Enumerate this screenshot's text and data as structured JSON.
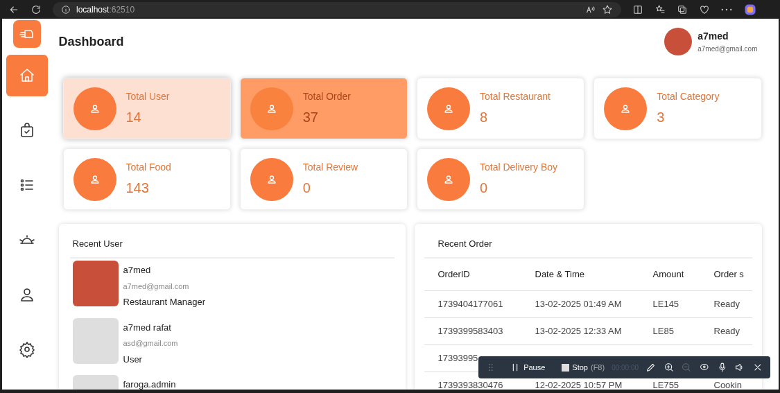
{
  "browser": {
    "url_host": "localhost",
    "url_port": ":62510"
  },
  "sidebar": {
    "items": [
      {
        "selected": true
      },
      {
        "selected": false
      },
      {
        "selected": false
      },
      {
        "selected": false
      },
      {
        "selected": false
      },
      {
        "selected": false
      }
    ]
  },
  "header": {
    "title": "Dashboard",
    "user": {
      "name": "a7med",
      "email": "a7med@gmail.com"
    }
  },
  "stats": [
    {
      "label": "Total User",
      "value": "14",
      "hovered": true,
      "selected": false
    },
    {
      "label": "Total Order",
      "value": "37",
      "hovered": false,
      "selected": true
    },
    {
      "label": "Total Restaurant",
      "value": "8",
      "hovered": false,
      "selected": false
    },
    {
      "label": "Total Category",
      "value": "3",
      "hovered": false,
      "selected": false
    },
    {
      "label": "Total Food",
      "value": "143",
      "hovered": false,
      "selected": false
    },
    {
      "label": "Total Review",
      "value": "0",
      "hovered": false,
      "selected": false
    },
    {
      "label": "Total Delivery Boy",
      "value": "0",
      "hovered": false,
      "selected": false
    }
  ],
  "recent_users": {
    "title": "Recent User",
    "users": [
      {
        "name": "a7med",
        "email": "a7med@gmail.com",
        "role": "Restaurant Manager",
        "photo": true
      },
      {
        "name": "a7med rafat",
        "email": "asd@gmail.com",
        "role": "User",
        "photo": false
      },
      {
        "name": "faroga.admin",
        "photo": false
      }
    ]
  },
  "recent_orders": {
    "title": "Recent Order",
    "columns": [
      "OrderID",
      "Date & Time",
      "Amount",
      "Order s"
    ],
    "rows": [
      [
        "1739404177061",
        "13-02-2025 01:49 AM",
        "LE145",
        "Ready"
      ],
      [
        "1739399583403",
        "13-02-2025 12:33 AM",
        "LE85",
        "Ready"
      ],
      [
        "17393995"
      ],
      [
        "1739393830476",
        "12-02-2025 10:57 PM",
        "LE755",
        "Cookin"
      ]
    ]
  },
  "recorder": {
    "pause": "Pause",
    "stop": "Stop",
    "shortcut": "(F8)",
    "timer": "00:00:00"
  }
}
